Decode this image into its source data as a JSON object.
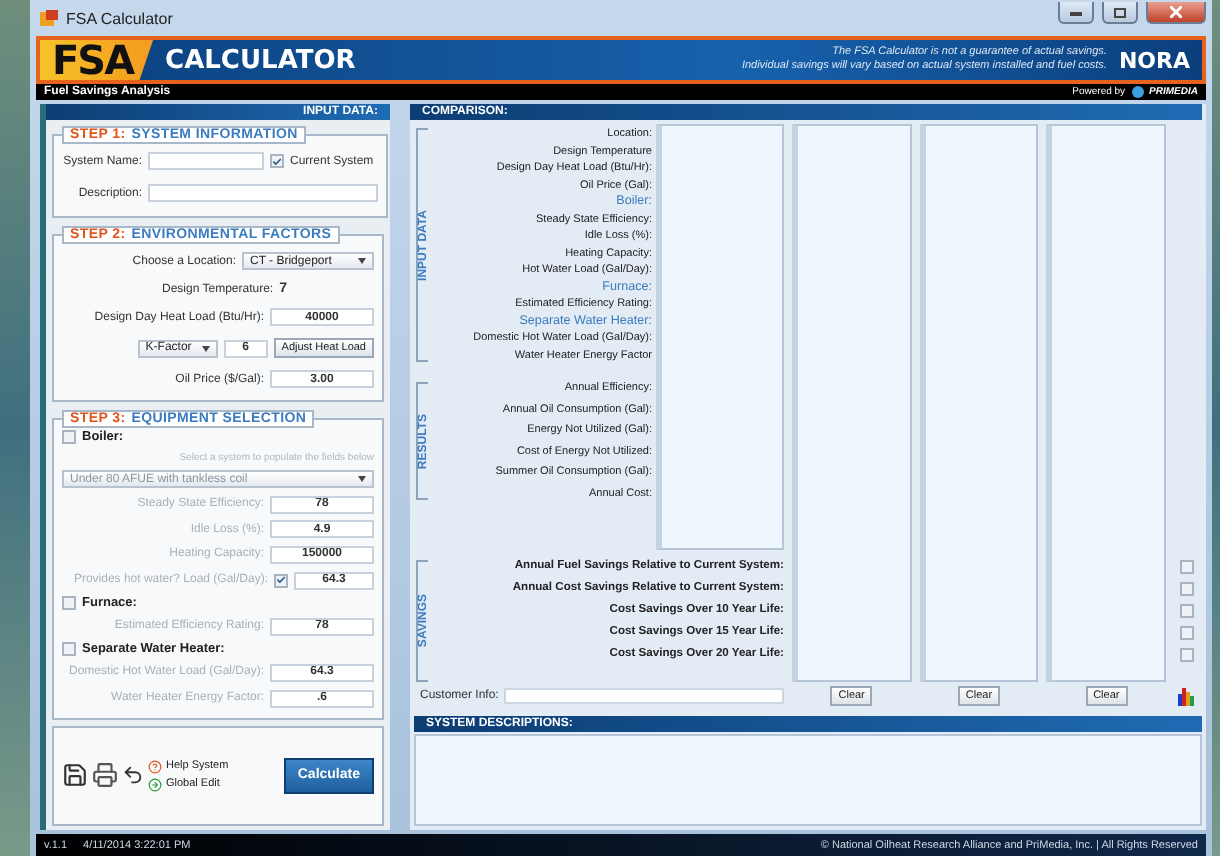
{
  "window": {
    "title": "FSA Calculator"
  },
  "header": {
    "logo": "FSA",
    "title": "CALCULATOR",
    "disclaimer": [
      "The FSA Calculator is not a guarantee of actual savings.",
      "Individual savings will vary based on actual system installed and fuel costs."
    ],
    "partner_logo": "NORA"
  },
  "subheader": {
    "title": "Fuel Savings Analysis",
    "powered_by": "Powered by",
    "sponsor": "PRIMEDIA"
  },
  "input_panel": {
    "title": "INPUT DATA:",
    "step1": {
      "step": "STEP 1:",
      "title": "SYSTEM INFORMATION",
      "system_name_label": "System Name:",
      "current_system": {
        "label": "Current System",
        "checked": true
      },
      "description_label": "Description:"
    },
    "step2": {
      "step": "STEP 2:",
      "title": "ENVIRONMENTAL FACTORS",
      "location": {
        "label": "Choose a Location:",
        "value": "CT - Bridgeport"
      },
      "design_temperature": {
        "label": "Design Temperature:",
        "value": "7"
      },
      "heat_load": {
        "label": "Design Day Heat Load (Btu/Hr):",
        "value": "40000"
      },
      "factor": {
        "value": "K-Factor",
        "number": "6"
      },
      "adjust_button": "Adjust Heat Load",
      "oil_price": {
        "label": "Oil Price ($/Gal):",
        "value": "3.00"
      }
    },
    "step3": {
      "step": "STEP 3:",
      "title": "EQUIPMENT SELECTION",
      "groups": [
        {
          "label": "Boiler:",
          "checked": false,
          "hint": "Select a system to populate the fields below",
          "select": "Under 80 AFUE with tankless coil",
          "fields": [
            {
              "label": "Steady State Efficiency:",
              "value": "78"
            },
            {
              "label": "Idle Loss (%):",
              "value": "4.9"
            },
            {
              "label": "Heating Capacity:",
              "value": "150000"
            },
            {
              "label": "Provides hot water? Load (Gal/Day):",
              "value": "64.3",
              "checked": true
            }
          ]
        },
        {
          "label": "Furnace:",
          "checked": false,
          "fields": [
            {
              "label": "Estimated Efficiency Rating:",
              "value": "78"
            }
          ]
        },
        {
          "label": "Separate Water Heater:",
          "checked": false,
          "fields": [
            {
              "label": "Domestic Hot Water Load (Gal/Day):",
              "value": "64.3"
            },
            {
              "label": "Water Heater Energy Factor:",
              "value": ".6"
            }
          ]
        }
      ]
    },
    "actions": {
      "help": "Help System",
      "global_edit": "Global Edit",
      "calculate": "Calculate"
    }
  },
  "comparison": {
    "title": "COMPARISON:",
    "sections": [
      {
        "title": "INPUT DATA",
        "rows": [
          {
            "kind": "field",
            "label": "Location:"
          },
          {
            "kind": "field",
            "label": "Design Temperature"
          },
          {
            "kind": "field",
            "label": "Design Day Heat Load (Btu/Hr):"
          },
          {
            "kind": "field",
            "label": "Oil Price (Gal):"
          },
          {
            "kind": "heading",
            "label": "Boiler:"
          },
          {
            "kind": "field",
            "label": "Steady State Efficiency:"
          },
          {
            "kind": "field",
            "label": "Idle Loss (%):"
          },
          {
            "kind": "field",
            "label": "Heating Capacity:"
          },
          {
            "kind": "field",
            "label": "Hot Water Load (Gal/Day):"
          },
          {
            "kind": "heading",
            "label": "Furnace:"
          },
          {
            "kind": "field",
            "label": "Estimated Efficiency Rating:"
          },
          {
            "kind": "heading",
            "label": "Separate Water Heater:"
          },
          {
            "kind": "field",
            "label": "Domestic Hot Water Load (Gal/Day):"
          },
          {
            "kind": "field",
            "label": "Water Heater Energy Factor"
          }
        ]
      },
      {
        "title": "RESULTS",
        "rows": [
          {
            "kind": "field",
            "label": "Annual Efficiency:"
          },
          {
            "kind": "field",
            "label": "Annual Oil Consumption (Gal):"
          },
          {
            "kind": "field",
            "label": "Energy Not Utilized (Gal):"
          },
          {
            "kind": "field",
            "label": "Cost of Energy Not Utilized:"
          },
          {
            "kind": "field",
            "label": "Summer Oil Consumption (Gal):"
          },
          {
            "kind": "field",
            "label": "Annual Cost:"
          }
        ]
      }
    ],
    "savings": {
      "title": "SAVINGS",
      "rows": [
        {
          "label": "Annual Fuel Savings Relative to Current System:",
          "checked": false
        },
        {
          "label": "Annual Cost Savings Relative to Current System:",
          "checked": false
        },
        {
          "label": "Cost Savings Over 10 Year Life:",
          "checked": false
        },
        {
          "label": "Cost Savings Over 15 Year Life:",
          "checked": false
        },
        {
          "label": "Cost Savings Over 20 Year Life:",
          "checked": false
        }
      ]
    },
    "clear_buttons": [
      "Clear",
      "Clear",
      "Clear"
    ],
    "customer_info_label": "Customer Info:"
  },
  "descriptions": {
    "title": "SYSTEM DESCRIPTIONS:"
  },
  "status_bar": {
    "version": "v.1.1",
    "timestamp": "4/11/2014 3:22:01 PM",
    "copyright": "© National Oilheat Research Alliance and PriMedia, Inc. | All Rights Reserved"
  }
}
